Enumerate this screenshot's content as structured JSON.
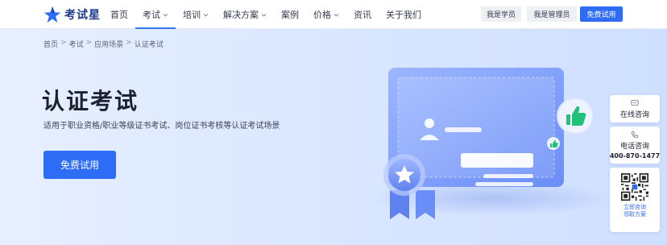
{
  "brand": {
    "name": "考试星"
  },
  "nav": {
    "items": [
      {
        "label": "首页",
        "dropdown": false,
        "active": false
      },
      {
        "label": "考试",
        "dropdown": true,
        "active": true
      },
      {
        "label": "培训",
        "dropdown": true,
        "active": false
      },
      {
        "label": "解决方案",
        "dropdown": true,
        "active": false
      },
      {
        "label": "案例",
        "dropdown": false,
        "active": false
      },
      {
        "label": "价格",
        "dropdown": true,
        "active": false
      },
      {
        "label": "资讯",
        "dropdown": false,
        "active": false
      },
      {
        "label": "关于我们",
        "dropdown": false,
        "active": false
      }
    ]
  },
  "header_buttons": {
    "student": "我是学员",
    "admin": "我是管理员",
    "trial": "免费试用"
  },
  "breadcrumb": {
    "home": "首页",
    "exam": "考试",
    "scenarios": "应用场景",
    "current": "认证考试",
    "separator": ">"
  },
  "hero": {
    "title": "认证考试",
    "subtitle": "适用于职业资格/职业等级证书考试、岗位证书考核等认证考试场景",
    "cta": "免费试用"
  },
  "float_panel": {
    "consult_online": "在线咨询",
    "consult_phone": "电话咨询",
    "phone_number": "400-870-1477",
    "qr_line1": "立即咨询",
    "qr_line2": "领取方案"
  },
  "colors": {
    "brand_blue": "#2f6cf5",
    "logo_blue": "#1e3a8a",
    "hero_bg": "#dbe8ff",
    "thumb_green": "#22c17a"
  },
  "icons": [
    "logo-star-icon",
    "chevron-down-icon",
    "avatar-icon",
    "star-badge-icon",
    "thumbs-up-icon",
    "chat-icon",
    "phone-icon",
    "qr-code-icon"
  ]
}
